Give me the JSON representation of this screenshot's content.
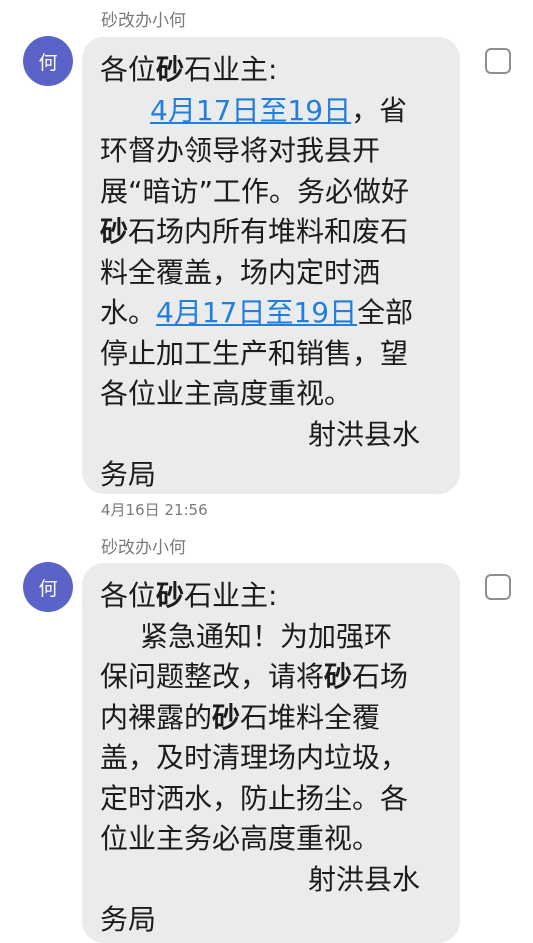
{
  "colors": {
    "avatar_bg": "#5b63c8",
    "bubble_bg": "#ebebeb",
    "link": "#1e7fe0"
  },
  "messages": [
    {
      "sender": "砂改办小何",
      "avatar_text": "何",
      "lines": [
        {
          "kind": "plain",
          "parts": [
            {
              "t": "各位"
            },
            {
              "t": "砂",
              "b": true
            },
            {
              "t": "石业主:"
            }
          ]
        },
        {
          "kind": "indent2",
          "parts": [
            {
              "t": "4月17日至19日",
              "link": true
            },
            {
              "t": "，省"
            }
          ]
        },
        {
          "kind": "plain",
          "parts": [
            {
              "t": "环督办领导将对我县开"
            }
          ]
        },
        {
          "kind": "plain",
          "parts": [
            {
              "t": "展“暗访”工作。务必做好"
            }
          ]
        },
        {
          "kind": "plain",
          "parts": [
            {
              "t": "砂",
              "b": true
            },
            {
              "t": "石场内所有堆料和废石"
            }
          ]
        },
        {
          "kind": "plain",
          "parts": [
            {
              "t": "料全覆盖，场内定时洒"
            }
          ]
        },
        {
          "kind": "plain",
          "parts": [
            {
              "t": "水。"
            },
            {
              "t": "4月17日至19日",
              "link": true
            },
            {
              "t": "全部"
            }
          ]
        },
        {
          "kind": "plain",
          "parts": [
            {
              "t": "停止加工生产和销售，望"
            }
          ]
        },
        {
          "kind": "plain",
          "parts": [
            {
              "t": "各位业主高度重视。"
            }
          ]
        },
        {
          "kind": "sig",
          "parts": [
            {
              "t": "射洪县水"
            }
          ]
        },
        {
          "kind": "plain",
          "parts": [
            {
              "t": "务局"
            }
          ]
        }
      ],
      "timestamp": "4月16日 21:56"
    },
    {
      "sender": "砂改办小何",
      "avatar_text": "何",
      "lines": [
        {
          "kind": "plain",
          "parts": [
            {
              "t": "各位"
            },
            {
              "t": "砂",
              "b": true
            },
            {
              "t": "石业主:"
            }
          ]
        },
        {
          "kind": "indent1",
          "parts": [
            {
              "t": "紧急通知！为加强环"
            }
          ]
        },
        {
          "kind": "plain",
          "parts": [
            {
              "t": "保问题整改，请将"
            },
            {
              "t": "砂",
              "b": true
            },
            {
              "t": "石场"
            }
          ]
        },
        {
          "kind": "plain",
          "parts": [
            {
              "t": "内裸露的"
            },
            {
              "t": "砂",
              "b": true
            },
            {
              "t": "石堆料全覆"
            }
          ]
        },
        {
          "kind": "plain",
          "parts": [
            {
              "t": "盖，及时清理场内垃圾，"
            }
          ]
        },
        {
          "kind": "plain",
          "parts": [
            {
              "t": "定时洒水，防止扬尘。各"
            }
          ]
        },
        {
          "kind": "plain",
          "parts": [
            {
              "t": "位业主务必高度重视。"
            }
          ]
        },
        {
          "kind": "sig",
          "parts": [
            {
              "t": "射洪县水"
            }
          ]
        },
        {
          "kind": "plain",
          "parts": [
            {
              "t": "务局"
            }
          ]
        }
      ]
    }
  ]
}
